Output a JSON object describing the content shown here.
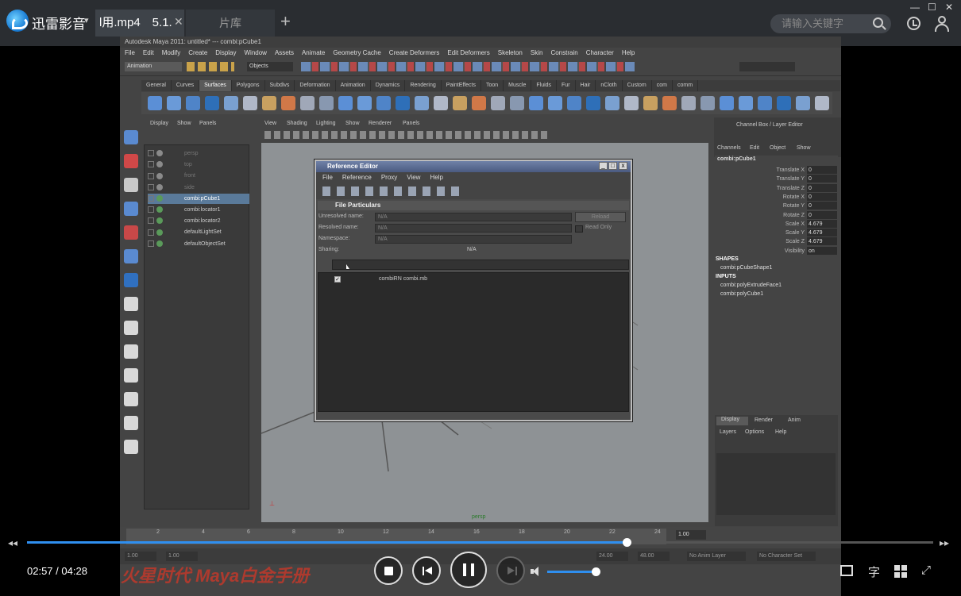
{
  "player": {
    "app_name": "迅雷影音",
    "tabs": [
      {
        "label": "l用.mp4　5.1."
      },
      {
        "label": "片库"
      }
    ],
    "search_placeholder": "请输入关键字",
    "time_current": "02:57",
    "time_separator": "/",
    "time_total": "04:28",
    "progress_fraction": 0.662,
    "volume_fraction": 1.0,
    "subtitle_button": "字",
    "accent_color": "#2f8ff0",
    "watermark": "火星时代 Maya白金手册"
  },
  "maya": {
    "title": "Autodesk Maya 2011: untitled*    ---    combi:pCube1",
    "menu": [
      "File",
      "Edit",
      "Modify",
      "Create",
      "Display",
      "Window",
      "Assets",
      "Animate",
      "Geometry Cache",
      "Create Deformers",
      "Edit Deformers",
      "Skeleton",
      "Skin",
      "Constrain",
      "Character",
      "Help"
    ],
    "mode": "Animation",
    "objects_field": "Objects",
    "shelf_tabs": [
      "General",
      "Curves",
      "Surfaces",
      "Polygons",
      "Subdivs",
      "Deformation",
      "Animation",
      "Dynamics",
      "Rendering",
      "PaintEffects",
      "Toon",
      "Muscle",
      "Fluids",
      "Fur",
      "Hair",
      "nCloth",
      "Custom",
      "com",
      "comm"
    ],
    "active_shelf": "Surfaces",
    "outliner_menu": [
      "Display",
      "Show",
      "Panels"
    ],
    "outliner_items": [
      {
        "label": "persp",
        "selected": false,
        "dim": true
      },
      {
        "label": "top",
        "selected": false,
        "dim": true
      },
      {
        "label": "front",
        "selected": false,
        "dim": true
      },
      {
        "label": "side",
        "selected": false,
        "dim": true
      },
      {
        "label": "combi:pCube1",
        "selected": true,
        "dim": false
      },
      {
        "label": "combi:locator1",
        "selected": false,
        "dim": false
      },
      {
        "label": "combi:locator2",
        "selected": false,
        "dim": false
      },
      {
        "label": "defaultLightSet",
        "selected": false,
        "dim": false
      },
      {
        "label": "defaultObjectSet",
        "selected": false,
        "dim": false
      }
    ],
    "viewport_menu": [
      "View",
      "Shading",
      "Lighting",
      "Show",
      "Renderer",
      "Panels"
    ],
    "viewport_label": "persp",
    "channel_box_title": "Channel Box / Layer Editor",
    "channel_menu": [
      "Channels",
      "Edit",
      "Object",
      "Show"
    ],
    "channel_object": "combi:pCube1",
    "channels": [
      {
        "label": "Translate X",
        "value": "0"
      },
      {
        "label": "Translate Y",
        "value": "0"
      },
      {
        "label": "Translate Z",
        "value": "0"
      },
      {
        "label": "Rotate X",
        "value": "0"
      },
      {
        "label": "Rotate Y",
        "value": "0"
      },
      {
        "label": "Rotate Z",
        "value": "0"
      },
      {
        "label": "Scale X",
        "value": "4.679"
      },
      {
        "label": "Scale Y",
        "value": "4.679"
      },
      {
        "label": "Scale Z",
        "value": "4.679"
      },
      {
        "label": "Visibility",
        "value": "on"
      }
    ],
    "shapes_header": "SHAPES",
    "shape": "combi:pCubeShape1",
    "inputs_header": "INPUTS",
    "inputs": [
      "combi:polyExtrudeFace1",
      "combi:polyCube1"
    ],
    "layer_tabs": [
      "Display",
      "Render",
      "Anim"
    ],
    "layer_menu": [
      "Layers",
      "Options",
      "Help"
    ],
    "timeline_ticks": [
      "2",
      "4",
      "6",
      "8",
      "10",
      "12",
      "14",
      "16",
      "18",
      "20",
      "22",
      "24"
    ],
    "current_frame": "1.00",
    "range_fields": [
      "1.00",
      "1.00",
      "24.00",
      "48.00"
    ],
    "anim_layer": "No Anim Layer",
    "char_set": "No Character Set"
  },
  "reference_editor": {
    "title": "Reference Editor",
    "menu": [
      "File",
      "Reference",
      "Proxy",
      "View",
      "Help"
    ],
    "section": "File Particulars",
    "fields": [
      {
        "label": "Unresolved name:",
        "value": "N/A"
      },
      {
        "label": "Resolved name:",
        "value": "N/A"
      },
      {
        "label": "Namespace:",
        "value": "N/A"
      }
    ],
    "reload_label": "Reload",
    "readonly_label": "Read Only",
    "sharing_label": "Sharing:",
    "sharing_value": "N/A",
    "reference_item": "combiRN combi.mb",
    "reference_checked": "✓"
  }
}
